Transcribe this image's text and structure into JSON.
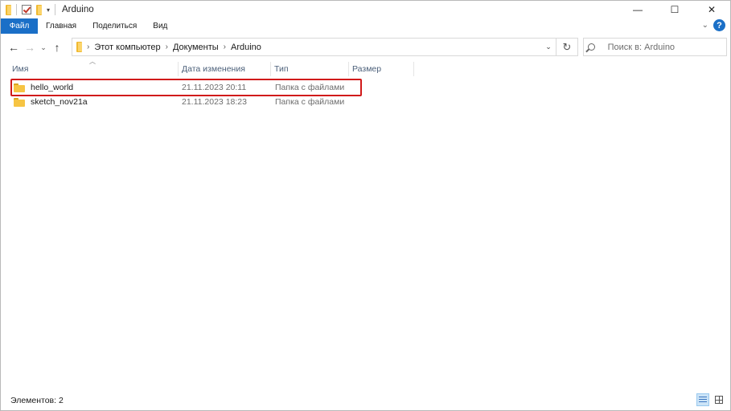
{
  "window": {
    "title": "Arduino",
    "controls": {
      "minimize": "—",
      "maximize": "☐",
      "close": "✕"
    }
  },
  "ribbon": {
    "tabs": [
      "Файл",
      "Главная",
      "Поделиться",
      "Вид"
    ],
    "help": "?"
  },
  "nav": {
    "back": "←",
    "forward": "→",
    "recent": "⌄",
    "up": "↑",
    "breadcrumbs": [
      "Этот компьютер",
      "Документы",
      "Arduino"
    ],
    "search_placeholder": "Поиск в: Arduino"
  },
  "columns": [
    "Имя",
    "Дата изменения",
    "Тип",
    "Размер"
  ],
  "files": [
    {
      "name": "hello_world",
      "date": "21.11.2023 20:11",
      "type": "Папка с файлами",
      "highlighted": true
    },
    {
      "name": "sketch_nov21a",
      "date": "21.11.2023 18:23",
      "type": "Папка с файлами",
      "highlighted": false
    }
  ],
  "status": {
    "items_count": "Элементов: 2"
  },
  "colors": {
    "file_tab": "#1a6fc7",
    "highlight_border": "#d11a1a",
    "folder": "#f6c443",
    "column_header_text": "#4c607a"
  }
}
